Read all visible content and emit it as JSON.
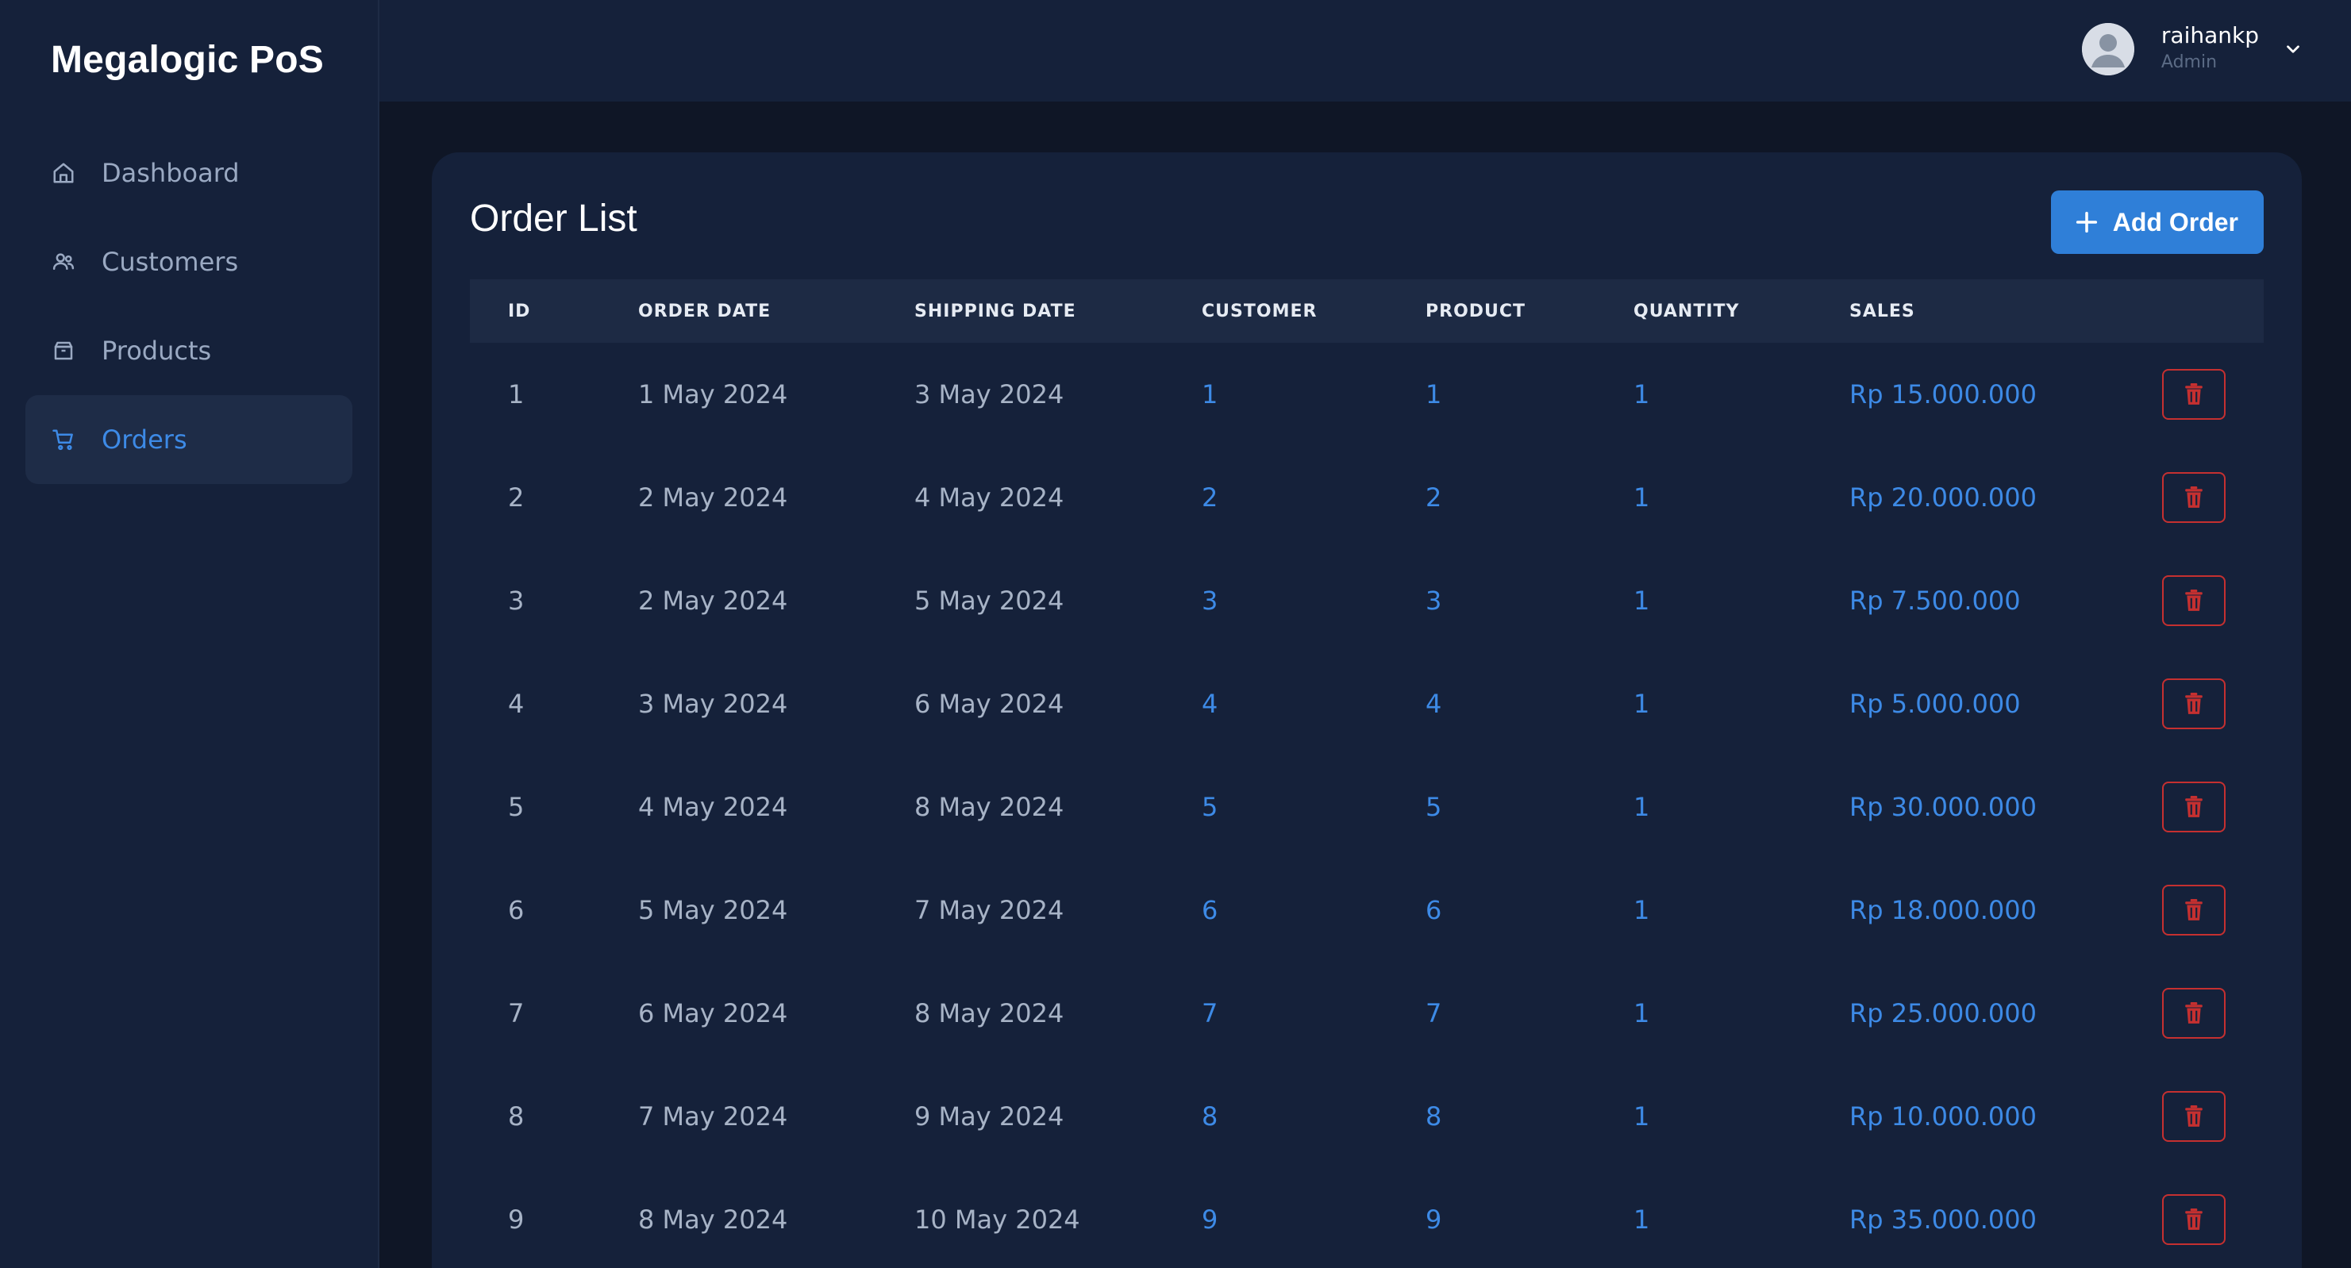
{
  "app": {
    "brand": "Megalogic PoS"
  },
  "sidebar": {
    "items": [
      {
        "label": "Dashboard",
        "icon": "home-icon",
        "active": false
      },
      {
        "label": "Customers",
        "icon": "users-icon",
        "active": false
      },
      {
        "label": "Products",
        "icon": "box-icon",
        "active": false
      },
      {
        "label": "Orders",
        "icon": "cart-icon",
        "active": true
      }
    ]
  },
  "user": {
    "name": "raihankp",
    "role": "Admin"
  },
  "main": {
    "title": "Order List",
    "add_button_label": "Add Order",
    "columns": [
      "ID",
      "ORDER DATE",
      "SHIPPING DATE",
      "CUSTOMER",
      "PRODUCT",
      "QUANTITY",
      "SALES"
    ],
    "rows": [
      {
        "id": "1",
        "order_date": "1 May 2024",
        "shipping_date": "3 May 2024",
        "customer": "1",
        "product": "1",
        "quantity": "1",
        "sales": "Rp 15.000.000"
      },
      {
        "id": "2",
        "order_date": "2 May 2024",
        "shipping_date": "4 May 2024",
        "customer": "2",
        "product": "2",
        "quantity": "1",
        "sales": "Rp 20.000.000"
      },
      {
        "id": "3",
        "order_date": "2 May 2024",
        "shipping_date": "5 May 2024",
        "customer": "3",
        "product": "3",
        "quantity": "1",
        "sales": "Rp 7.500.000"
      },
      {
        "id": "4",
        "order_date": "3 May 2024",
        "shipping_date": "6 May 2024",
        "customer": "4",
        "product": "4",
        "quantity": "1",
        "sales": "Rp 5.000.000"
      },
      {
        "id": "5",
        "order_date": "4 May 2024",
        "shipping_date": "8 May 2024",
        "customer": "5",
        "product": "5",
        "quantity": "1",
        "sales": "Rp 30.000.000"
      },
      {
        "id": "6",
        "order_date": "5 May 2024",
        "shipping_date": "7 May 2024",
        "customer": "6",
        "product": "6",
        "quantity": "1",
        "sales": "Rp 18.000.000"
      },
      {
        "id": "7",
        "order_date": "6 May 2024",
        "shipping_date": "8 May 2024",
        "customer": "7",
        "product": "7",
        "quantity": "1",
        "sales": "Rp 25.000.000"
      },
      {
        "id": "8",
        "order_date": "7 May 2024",
        "shipping_date": "9 May 2024",
        "customer": "8",
        "product": "8",
        "quantity": "1",
        "sales": "Rp 10.000.000"
      },
      {
        "id": "9",
        "order_date": "8 May 2024",
        "shipping_date": "10 May 2024",
        "customer": "9",
        "product": "9",
        "quantity": "1",
        "sales": "Rp 35.000.000"
      }
    ]
  },
  "colors": {
    "accent": "#3d8ae6",
    "danger": "#c53030",
    "panel": "#15213a",
    "background": "#0f1626"
  }
}
